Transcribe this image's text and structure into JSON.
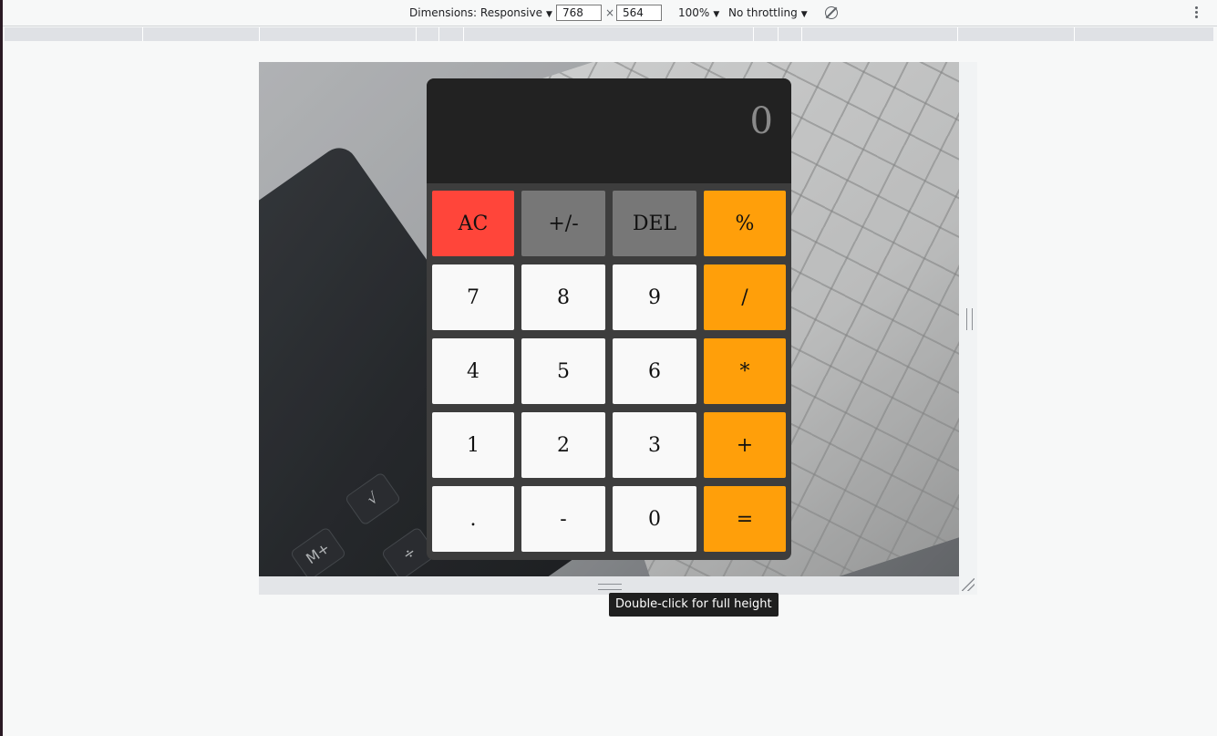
{
  "toolbar": {
    "dimensions_label": "Dimensions: Responsive",
    "width_value": "768",
    "times": "×",
    "height_value": "564",
    "zoom": "100%",
    "throttling": "No throttling",
    "rotate_icon": "rotate-icon",
    "menu_icon": "more-vert-icon"
  },
  "calculator": {
    "display": "0",
    "buttons": [
      {
        "label": "AC",
        "kind": "clear"
      },
      {
        "label": "+/-",
        "kind": "function"
      },
      {
        "label": "DEL",
        "kind": "function"
      },
      {
        "label": "%",
        "kind": "operator"
      },
      {
        "label": "7",
        "kind": "number"
      },
      {
        "label": "8",
        "kind": "number"
      },
      {
        "label": "9",
        "kind": "number"
      },
      {
        "label": "/",
        "kind": "operator"
      },
      {
        "label": "4",
        "kind": "number"
      },
      {
        "label": "5",
        "kind": "number"
      },
      {
        "label": "6",
        "kind": "number"
      },
      {
        "label": "*",
        "kind": "operator"
      },
      {
        "label": "1",
        "kind": "number"
      },
      {
        "label": "2",
        "kind": "number"
      },
      {
        "label": "3",
        "kind": "number"
      },
      {
        "label": "+",
        "kind": "operator"
      },
      {
        "label": ".",
        "kind": "number"
      },
      {
        "label": "-",
        "kind": "number"
      },
      {
        "label": "0",
        "kind": "number"
      },
      {
        "label": "=",
        "kind": "operator"
      }
    ],
    "colors": {
      "clear": "#ff453a",
      "function": "#777777",
      "operator": "#ff9f0a",
      "number": "#f9f9f9",
      "display_bg": "#222222",
      "body_bg": "#3d3d3d"
    }
  },
  "tooltip": "Double-click for full height"
}
